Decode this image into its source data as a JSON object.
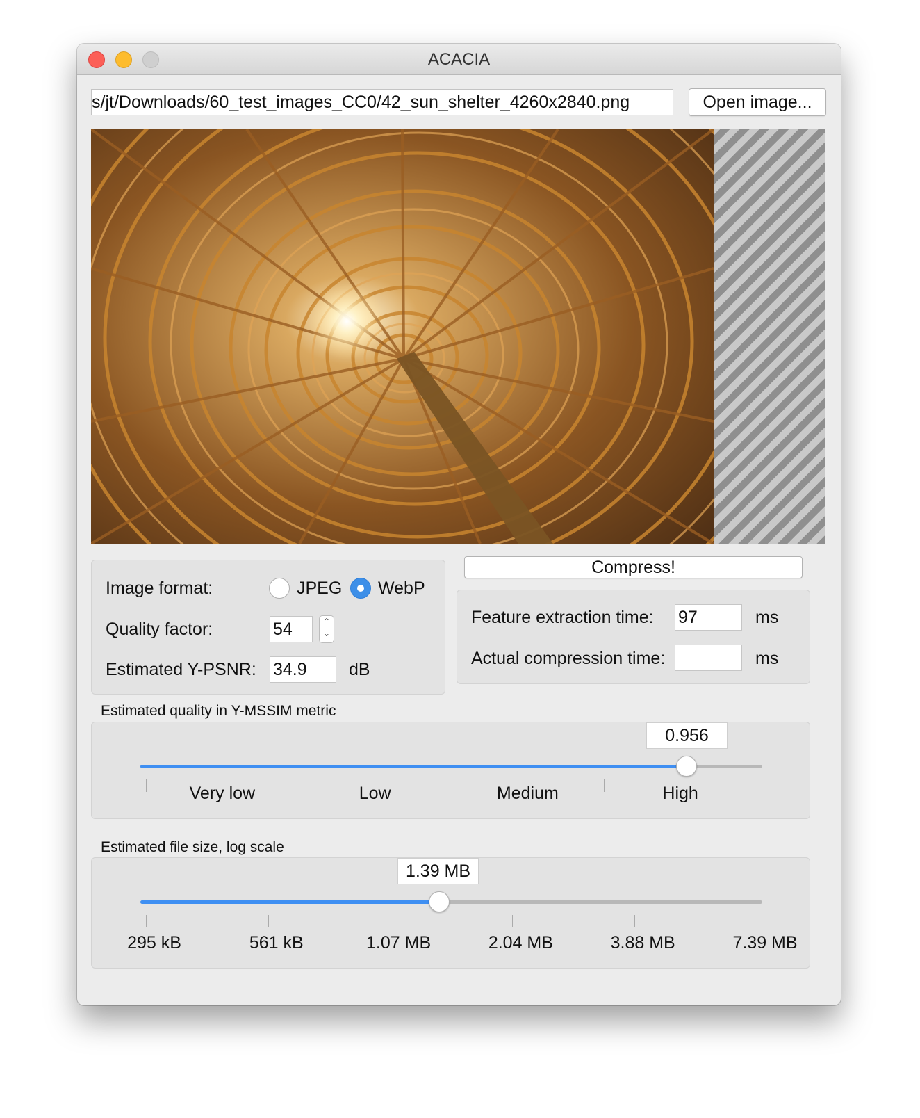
{
  "window": {
    "title": "ACACIA"
  },
  "file": {
    "path": "s/jt/Downloads/60_test_images_CC0/42_sun_shelter_4260x2840.png",
    "open_button": "Open image..."
  },
  "format_panel": {
    "format_label": "Image format:",
    "options": [
      {
        "label": "JPEG",
        "selected": false
      },
      {
        "label": "WebP",
        "selected": true
      }
    ],
    "quality_label": "Quality factor:",
    "quality_value": "54",
    "psnr_label": "Estimated Y-PSNR:",
    "psnr_value": "34.9",
    "psnr_unit": "dB"
  },
  "compress_panel": {
    "compress_button": "Compress!",
    "feature_label": "Feature extraction time:",
    "feature_value": "97",
    "feature_unit": "ms",
    "actual_label": "Actual compression time:",
    "actual_value": "",
    "actual_unit": "ms"
  },
  "quality_slider": {
    "title": "Estimated quality in Y-MSSIM metric",
    "value_text": "0.956",
    "position_fraction": 0.878,
    "labels": [
      "Very low",
      "Low",
      "Medium",
      "High"
    ]
  },
  "size_slider": {
    "title": "Estimated file size, log scale",
    "value_text": "1.39 MB",
    "position_fraction": 0.48,
    "labels": [
      "295 kB",
      "561 kB",
      "1.07 MB",
      "2.04 MB",
      "3.88 MB",
      "7.39 MB"
    ]
  },
  "colors": {
    "accent": "#3f8ff2",
    "close": "#fc5f57",
    "minimize": "#fdbc2e",
    "zoom_disabled": "#cfcfcf"
  }
}
